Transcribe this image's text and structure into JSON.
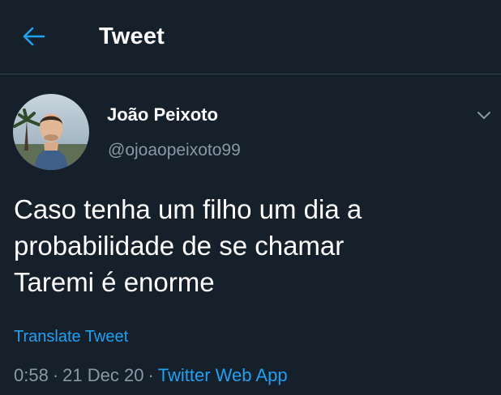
{
  "header": {
    "title": "Tweet",
    "back_icon": "arrow-left-icon"
  },
  "tweet": {
    "author": {
      "display_name": "João Peixoto",
      "handle": "@ojoaopeixoto99"
    },
    "text": "Caso tenha um filho um dia a\nprobabilidade de se chamar\nTaremi é enorme",
    "translate_label": "Translate Tweet",
    "time": "0:58",
    "date": "21 Dec 20",
    "separator": "·",
    "source": "Twitter Web App",
    "more_icon": "chevron-down-icon"
  },
  "colors": {
    "background": "#15202b",
    "accent": "#1da1f2",
    "secondary_text": "#8899a6",
    "divider": "#38444d"
  }
}
